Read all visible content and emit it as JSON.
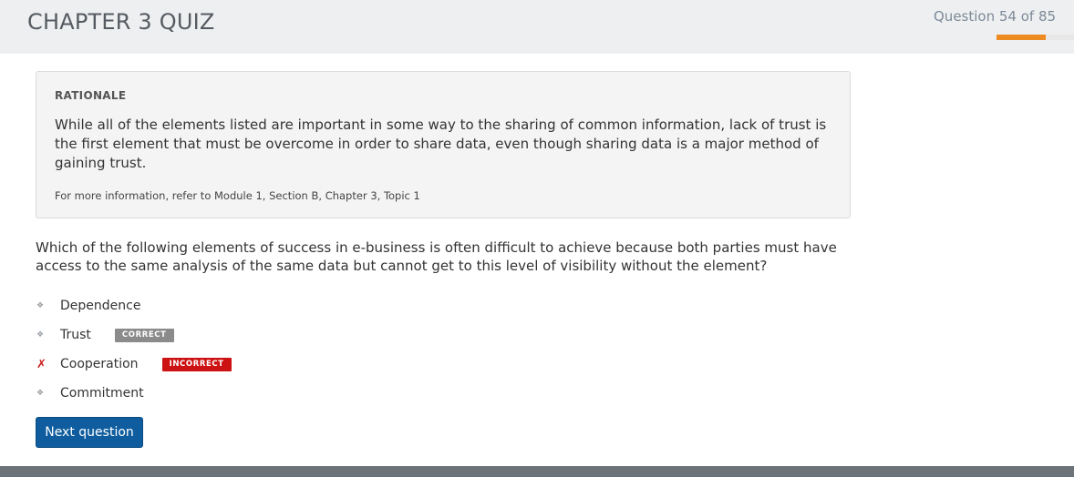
{
  "header": {
    "title": "CHAPTER 3 QUIZ",
    "progress_text": "Question 54 of 85",
    "progress_fraction": 0.635,
    "accent_color": "#ee8a22"
  },
  "rationale": {
    "heading": "RATIONALE",
    "body": "While all of the elements listed are important in some way to the sharing of common information, lack of trust is the first element that must be overcome in order to share data, even though sharing data is a major method of gaining trust.",
    "reference": "For more information, refer to Module 1, Section B, Chapter 3, Topic 1"
  },
  "question": {
    "text": "Which of the following elements of success in e-business is often difficult to achieve because both parties must have access to the same analysis of the same data but cannot get to this level of visibility without the element?"
  },
  "answers": [
    {
      "label": "Dependence",
      "marker": "bullet-diamond-icon"
    },
    {
      "label": "Trust",
      "marker": "bullet-diamond-icon",
      "badge": "CORRECT"
    },
    {
      "label": "Cooperation",
      "marker": "red-x-icon",
      "badge": "INCORRECT"
    },
    {
      "label": "Commitment",
      "marker": "bullet-diamond-icon"
    }
  ],
  "colors": {
    "correct_badge": "#8b8b8b",
    "incorrect_badge": "#cc1212",
    "primary_button": "#0f5d9e"
  },
  "actions": {
    "next_label": "Next question"
  }
}
